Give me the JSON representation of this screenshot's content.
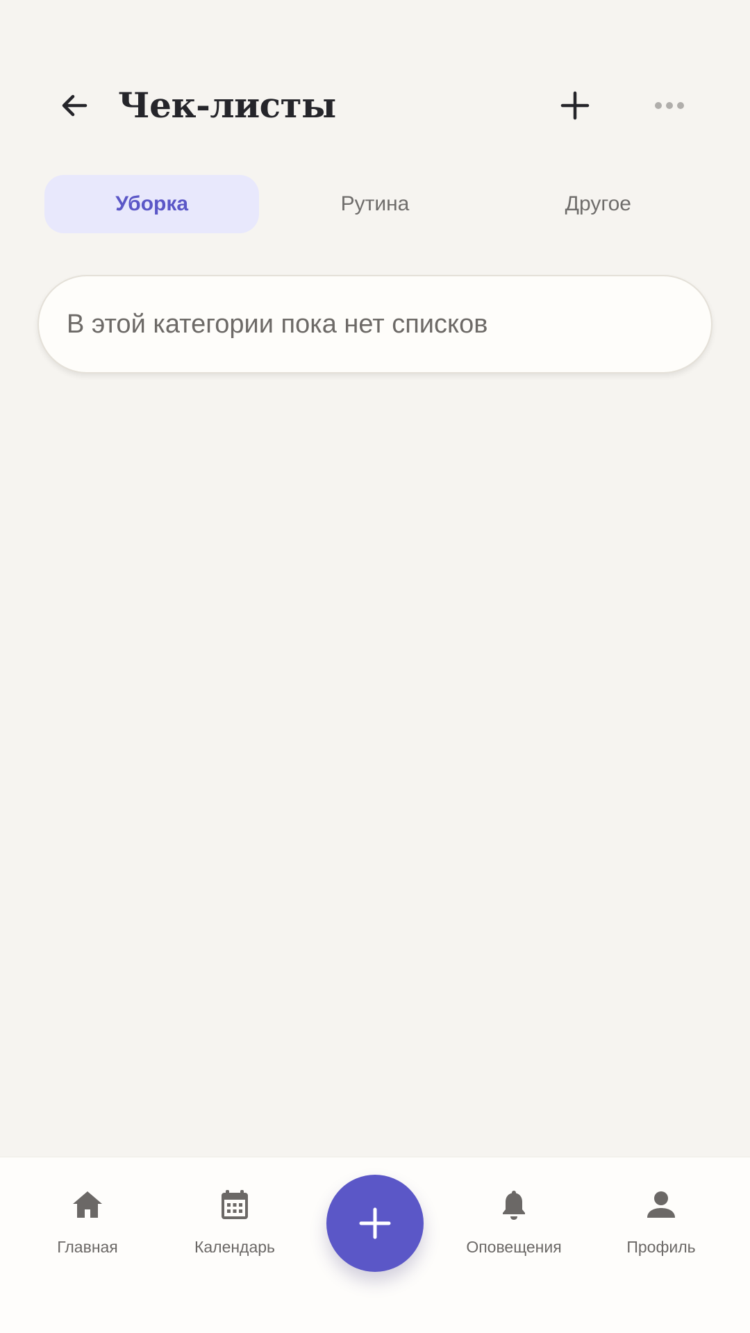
{
  "header": {
    "title": "Чек-листы",
    "back_icon": "arrow-left-icon",
    "add_icon": "plus-icon",
    "more_icon": "more-horizontal-icon"
  },
  "tabs": [
    {
      "label": "Уборка",
      "active": true
    },
    {
      "label": "Рутина",
      "active": false
    },
    {
      "label": "Другое",
      "active": false
    }
  ],
  "empty_state": {
    "message": "В этой категории пока нет списков"
  },
  "bottom_nav": {
    "items": [
      {
        "label": "Главная",
        "icon": "home-icon"
      },
      {
        "label": "Календарь",
        "icon": "calendar-icon"
      },
      {
        "label": "Оповещения",
        "icon": "bell-icon"
      },
      {
        "label": "Профиль",
        "icon": "person-icon"
      }
    ],
    "fab_icon": "plus-icon"
  },
  "colors": {
    "accent": "#5b57c7",
    "active_tab_bg": "#e8e8fc",
    "background": "#f6f4f0",
    "card": "#fefdfa"
  }
}
